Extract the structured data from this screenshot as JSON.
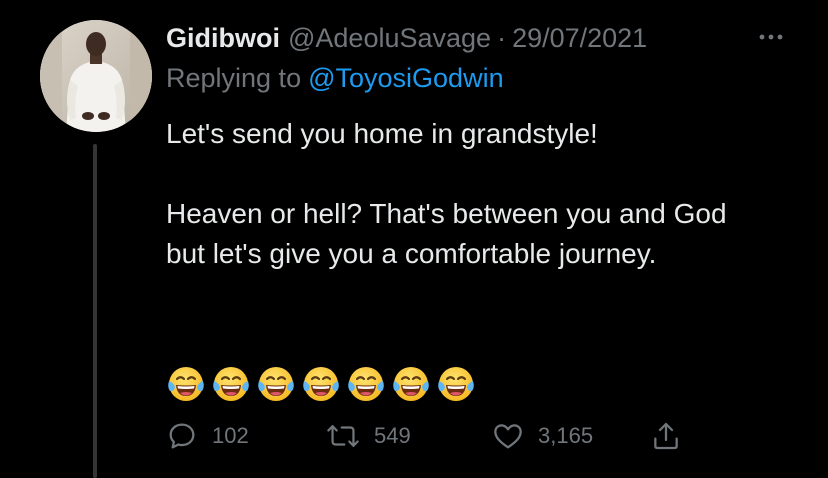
{
  "tweet": {
    "display_name": "Gidibwoi",
    "handle": "@AdeoluSavage",
    "separator": "·",
    "date": "29/07/2021",
    "more_icon": "more-horizontal-icon",
    "replying_to_label": "Replying to",
    "replying_to_handle": "@ToyosiGodwin",
    "text_lines": [
      "Let's send you home in grandstyle!",
      "Heaven or hell? That's between you and God but let's give you a comfortable journey."
    ],
    "emoji_count": 7,
    "emoji_name": "face-with-tears-of-joy"
  },
  "actions": {
    "reply": {
      "icon": "reply-icon",
      "count": "102"
    },
    "retweet": {
      "icon": "retweet-icon",
      "count": "549"
    },
    "like": {
      "icon": "heart-icon",
      "count": "3,165"
    },
    "share": {
      "icon": "share-icon"
    }
  },
  "colors": {
    "background": "#000000",
    "primary_text": "#e7e9ea",
    "secondary_text": "#71767b",
    "link": "#1d9bf0",
    "thread_line": "#333639"
  }
}
